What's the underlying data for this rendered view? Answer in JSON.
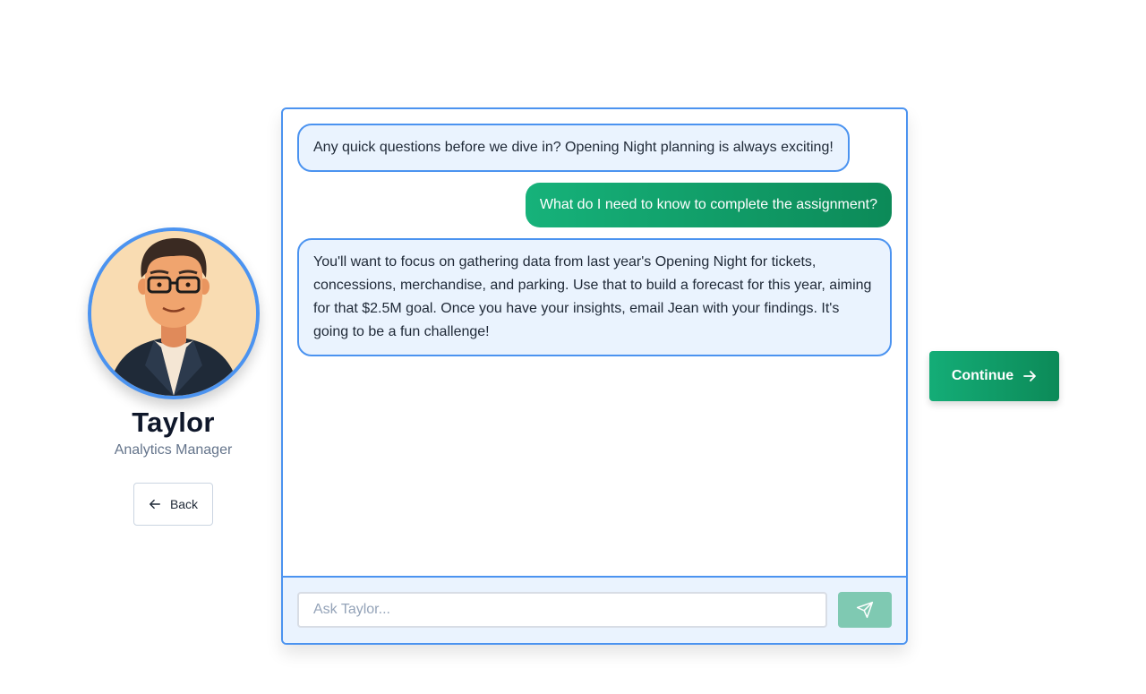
{
  "profile": {
    "name": "Taylor",
    "role": "Analytics Manager",
    "back_label": "Back",
    "avatar_icon": "person-avatar-illustration"
  },
  "chat": {
    "messages": [
      {
        "sender": "bot",
        "text": "Any quick questions before we dive in? Opening Night planning is always exciting!"
      },
      {
        "sender": "user",
        "text": "What do I need to know to complete the assignment?"
      },
      {
        "sender": "bot",
        "text": "You'll want to focus on gathering data from last year's Opening Night for tickets, concessions, merchandise, and parking. Use that to build a forecast for this year, aiming for that $2.5M goal. Once you have your insights, email Jean with your findings. It's going to be a fun challenge!"
      }
    ],
    "input_placeholder": "Ask Taylor...",
    "input_value": "",
    "send_icon": "send-icon"
  },
  "actions": {
    "continue_label": "Continue"
  },
  "colors": {
    "accent_blue": "#4b93f0",
    "bubble_bg": "#eaf3fe",
    "green": "#14ad77",
    "green_dark": "#0c8a58"
  }
}
